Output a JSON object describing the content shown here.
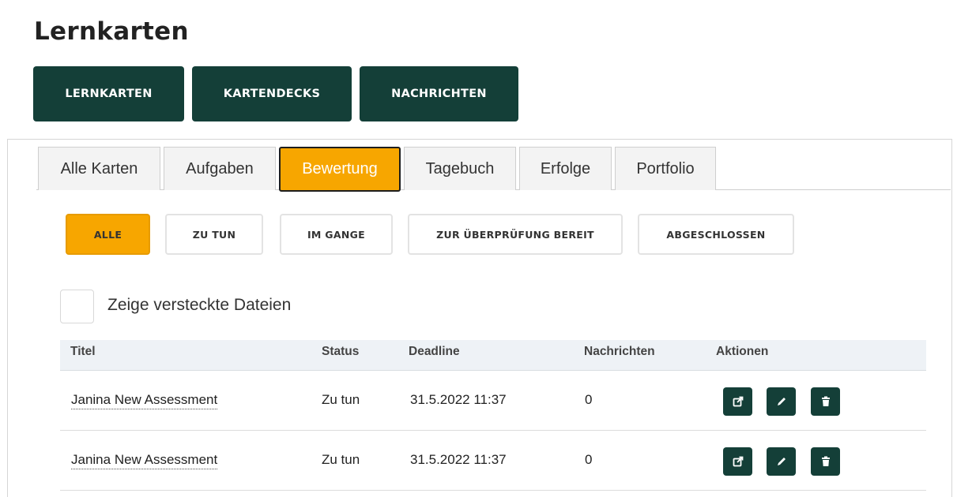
{
  "header": {
    "title": "Lernkarten"
  },
  "main_nav": {
    "items": [
      "LERNKARTEN",
      "KARTENDECKS",
      "NACHRICHTEN"
    ]
  },
  "tabs": {
    "items": [
      "Alle Karten",
      "Aufgaben",
      "Bewertung",
      "Tagebuch",
      "Erfolge",
      "Portfolio"
    ],
    "active": "Bewertung"
  },
  "filters": {
    "items": [
      "ALLE",
      "ZU TUN",
      "IM GANGE",
      "ZUR ÜBERPRÜFUNG BEREIT",
      "ABGESCHLOSSEN"
    ],
    "active": "ALLE"
  },
  "hidden_files": {
    "label": "Zeige versteckte Dateien",
    "checked": false
  },
  "table": {
    "headers": {
      "titel": "Titel",
      "status": "Status",
      "deadline": "Deadline",
      "nachrichten": "Nachrichten",
      "aktionen": "Aktionen"
    },
    "rows": [
      {
        "titel": "Janina New Assessment",
        "status": "Zu tun",
        "deadline": "31.5.2022 11:37",
        "nachrichten": "0"
      },
      {
        "titel": "Janina New Assessment",
        "status": "Zu tun",
        "deadline": "31.5.2022 11:37",
        "nachrichten": "0"
      }
    ],
    "action_icons": [
      "external-link-icon",
      "pencil-icon",
      "trash-icon"
    ]
  },
  "colors": {
    "primary_dark_green": "#143f38",
    "accent_orange": "#f7a600",
    "table_header_bg": "#eef2f6"
  }
}
